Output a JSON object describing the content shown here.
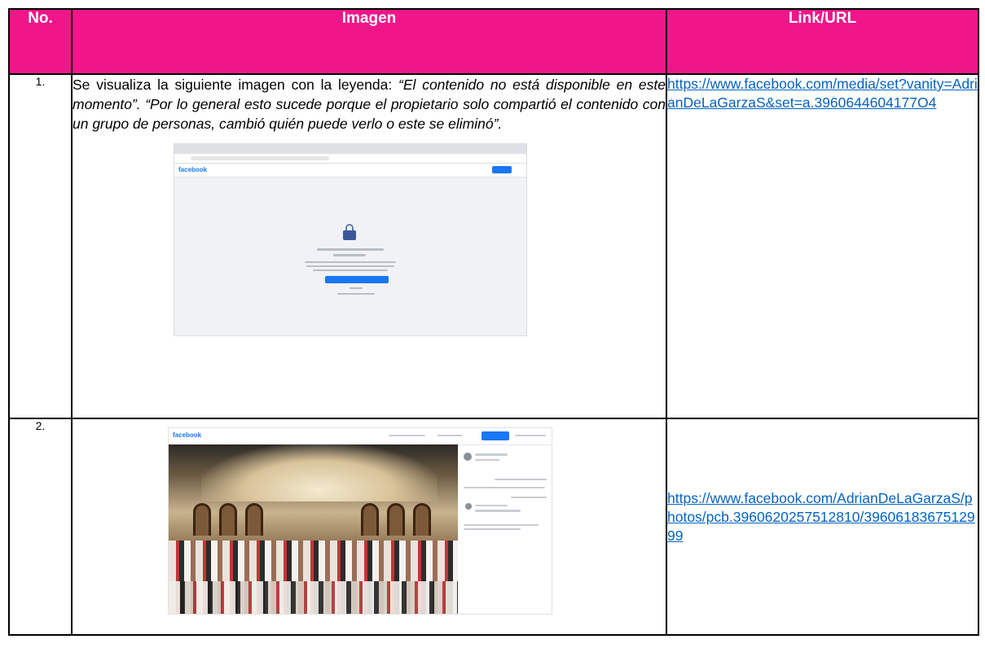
{
  "table": {
    "headers": {
      "no": "No.",
      "imagen": "Imagen",
      "link": "Link/URL"
    },
    "rows": [
      {
        "no": "1.",
        "description_plain": "Se visualiza la siguiente imagen con la leyenda: ",
        "description_italic": "“El contenido no está disponible en este momento”. “Por lo general esto sucede porque el propietario solo compartió el contenido con un grupo de personas, cambió quién puede verlo o este se eliminó”.",
        "screenshot_logo": "facebook",
        "url": "https://www.facebook.com/media/set?vanity=AdrianDeLaGarzaS&set=a.3960644604177O4"
      },
      {
        "no": "2.",
        "screenshot_logo": "facebook",
        "url": "https://www.facebook.com/AdrianDeLaGarzaS/photos/pcb.3960620257512810/3960618367512999"
      }
    ]
  },
  "colors": {
    "header_bg": "#f0168a",
    "header_text": "#ffffff",
    "link": "#0563c1",
    "facebook_blue": "#1877f2"
  }
}
